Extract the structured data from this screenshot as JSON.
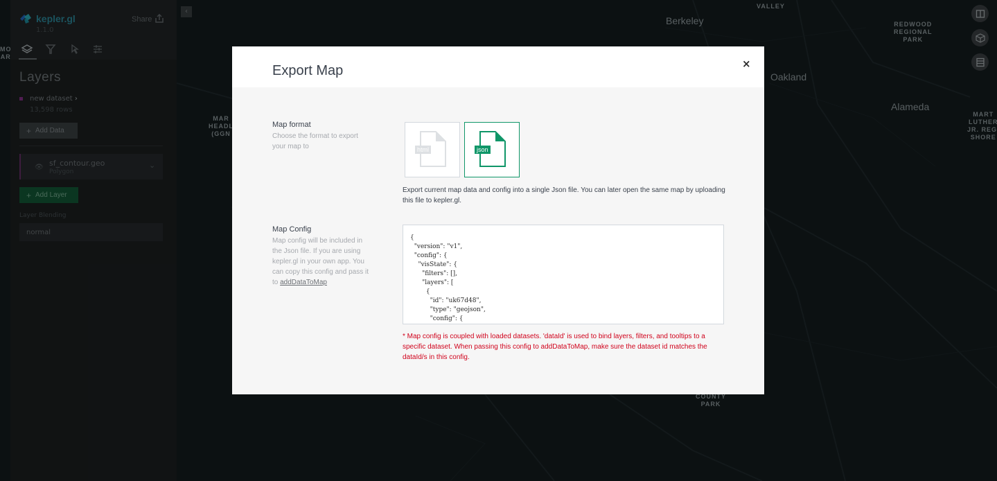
{
  "app": {
    "name": "kepler.gl",
    "version": "1.1.0",
    "share_label": "Share"
  },
  "side_panel": {
    "tabs": [
      {
        "icon": "layers-icon",
        "active": true
      },
      {
        "icon": "filter-icon",
        "active": false
      },
      {
        "icon": "interaction-icon",
        "active": false
      },
      {
        "icon": "map-settings-icon",
        "active": false
      }
    ],
    "section_title": "Layers",
    "dataset": {
      "name": "new dataset",
      "rows": "13,598 rows",
      "color": "#8b2c8c"
    },
    "add_data_label": "Add Data",
    "layer": {
      "name": "sf_contour.geo",
      "type": "Polygon"
    },
    "add_layer_label": "Add Layer",
    "blending_label": "Layer Blending",
    "blending_value": "normal"
  },
  "map_labels": {
    "berkeley": "Berkeley",
    "oakland": "Oakland",
    "alameda": "Alameda",
    "valley": "VALLEY",
    "redwood": "REDWOOD\nREGIONAL\nPARK",
    "martin": "MART\nLUTHER\nJR. REGI\nSHORE",
    "county_park": "COUNTY\nPARK",
    "mar_headl": "MAR\nHEADL\n(GGN",
    "mo_left": "MO\nAR"
  },
  "modal": {
    "title": "Export Map",
    "close_label": "×",
    "map_format": {
      "title": "Map format",
      "description": "Choose the format to export your map to",
      "options": [
        {
          "label": "html",
          "selected": false
        },
        {
          "label": "json",
          "selected": true
        }
      ],
      "selected_description": "Export current map data and config into a single Json file. You can later open the same map by uploading this file to kepler.gl."
    },
    "map_config": {
      "title": "Map Config",
      "description_prefix": "Map config will be included in the Json file. If you are using kepler.gl in your own app. You can copy this config and pass it to ",
      "description_link": "addDataToMap",
      "code": "{\n  \"version\": \"v1\",\n  \"config\": {\n    \"visState\": {\n      \"filters\": [],\n      \"layers\": [\n        {\n          \"id\": \"uk67d48\",\n          \"type\": \"geojson\",\n          \"config\": {",
      "warning": "* Map config is coupled with loaded datasets. 'dataId' is used to bind layers, filters, and tooltips to a specific dataset. When passing this config to addDataToMap, make sure the dataset id matches the dataId/s in this config."
    }
  },
  "colors": {
    "accent": "#0f9668",
    "warning": "#d0021b",
    "brand": "#2a8fa3"
  }
}
